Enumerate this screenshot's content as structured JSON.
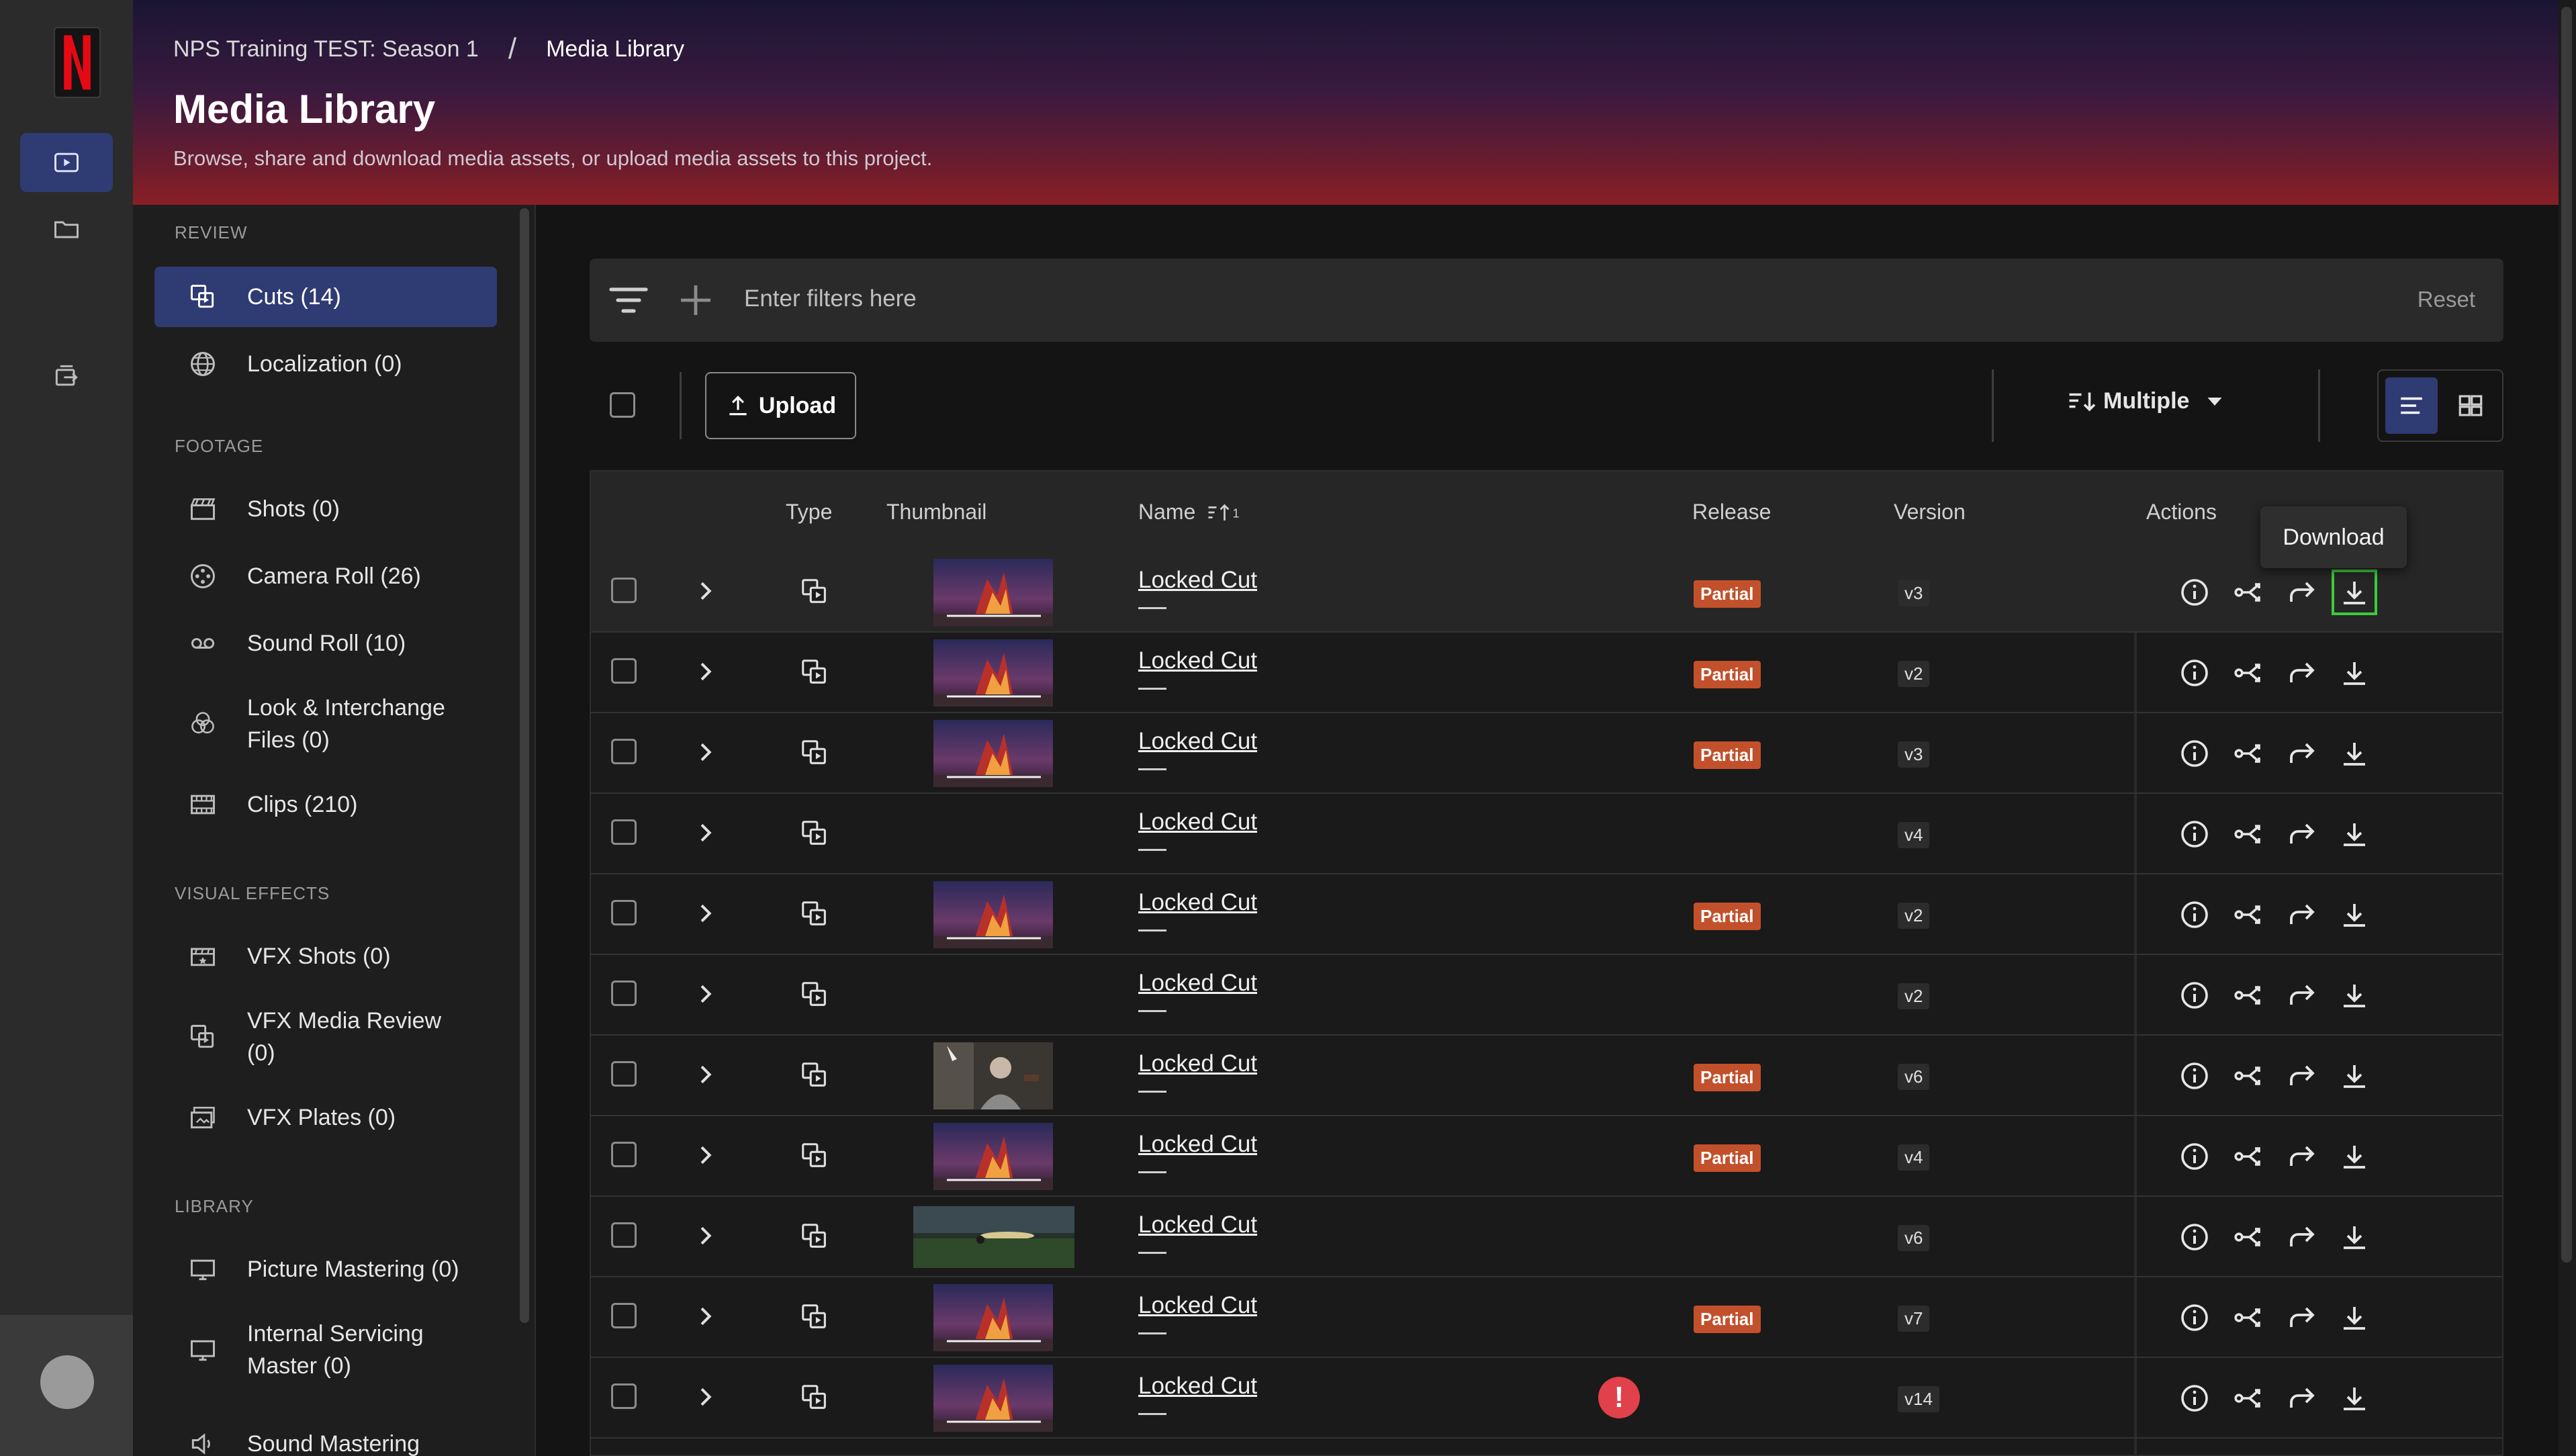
{
  "header": {
    "breadcrumb_project": "NPS Training TEST: Season 1",
    "breadcrumb_sep": "/",
    "breadcrumb_current": "Media Library",
    "title": "Media Library",
    "subtitle": "Browse, share and download media assets, or upload media assets to this project."
  },
  "sidebar": {
    "sections": {
      "review": "REVIEW",
      "footage": "FOOTAGE",
      "vfx": "VISUAL EFFECTS",
      "library": "LIBRARY"
    },
    "items": {
      "cuts": "Cuts (14)",
      "localization": "Localization (0)",
      "shots": "Shots (0)",
      "camera_roll": "Camera Roll (26)",
      "sound_roll": "Sound Roll (10)",
      "look_line1": "Look & Interchange",
      "look_line2": "Files (0)",
      "clips": "Clips (210)",
      "vfx_shots": "VFX Shots (0)",
      "vfx_review_line1": "VFX Media Review",
      "vfx_review_line2": "(0)",
      "vfx_plates": "VFX Plates (0)",
      "picture_mastering": "Picture Mastering (0)",
      "internal_line1": "Internal Servicing",
      "internal_line2": "Master (0)",
      "sound_mastering": "Sound Mastering"
    }
  },
  "filter": {
    "placeholder": "Enter filters here",
    "reset_label": "Reset"
  },
  "toolbar": {
    "upload_label": "Upload",
    "sort_label": "Multiple"
  },
  "table": {
    "headers": {
      "type": "Type",
      "thumbnail": "Thumbnail",
      "name": "Name",
      "release": "Release",
      "version": "Version",
      "actions": "Actions"
    },
    "rows": [
      {
        "name": "Locked Cut",
        "release": "Partial",
        "version": "v3"
      },
      {
        "name": "Locked Cut",
        "release": "Partial",
        "version": "v2"
      },
      {
        "name": "Locked Cut",
        "release": "Partial",
        "version": "v3"
      },
      {
        "name": "Locked Cut",
        "release": "",
        "version": "v4"
      },
      {
        "name": "Locked Cut",
        "release": "Partial",
        "version": "v2"
      },
      {
        "name": "Locked Cut",
        "release": "",
        "version": "v2"
      },
      {
        "name": "Locked Cut",
        "release": "Partial",
        "version": "v6"
      },
      {
        "name": "Locked Cut",
        "release": "Partial",
        "version": "v4"
      },
      {
        "name": "Locked Cut",
        "release": "",
        "version": "v6"
      },
      {
        "name": "Locked Cut",
        "release": "Partial",
        "version": "v7"
      },
      {
        "name": "Locked Cut",
        "release": "",
        "version": "v14"
      }
    ]
  },
  "tooltip": {
    "text": "Download"
  },
  "colors": {
    "accent": "#2f3b73",
    "partial_badge": "#c2502b",
    "warning": "#e0414a",
    "focus_outline": "#3bcb3b"
  },
  "icons": [
    "netflix-logo",
    "play-icon",
    "folder-icon",
    "export-icon",
    "filter-icon",
    "plus-icon",
    "upload-icon",
    "sort-icon",
    "chevron-down-icon",
    "list-view-icon",
    "grid-view-icon",
    "chevron-right-icon",
    "cut-icon",
    "info-icon",
    "share-icon",
    "forward-icon",
    "download-icon",
    "warning-icon"
  ]
}
